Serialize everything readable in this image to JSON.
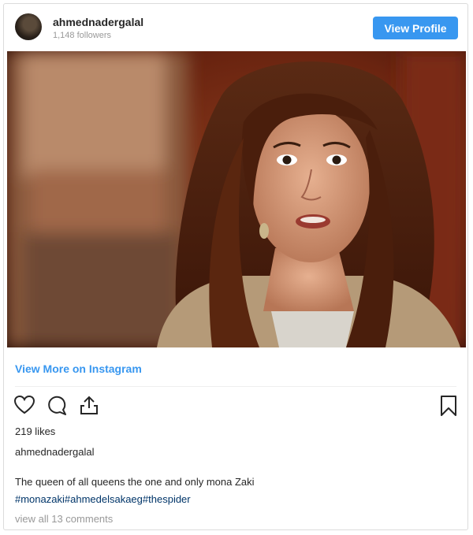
{
  "header": {
    "username": "ahmednadergalal",
    "followers": "1,148 followers",
    "view_profile_label": "View Profile"
  },
  "links": {
    "view_more": "View More on Instagram"
  },
  "post": {
    "likes": "219 likes",
    "caption_user": "ahmednadergalal",
    "caption_text": "The queen of all queens the one and only mona Zaki",
    "hashtags": [
      "#monazaki",
      "#ahmedelsakaeg",
      "#thespider"
    ],
    "comments_link": "view all 13 comments"
  },
  "icons": [
    "heart-icon",
    "comment-icon",
    "share-icon",
    "bookmark-icon"
  ],
  "colors": {
    "accent": "#3897f0",
    "hashtag": "#003569",
    "muted": "#999999",
    "text": "#262626"
  }
}
